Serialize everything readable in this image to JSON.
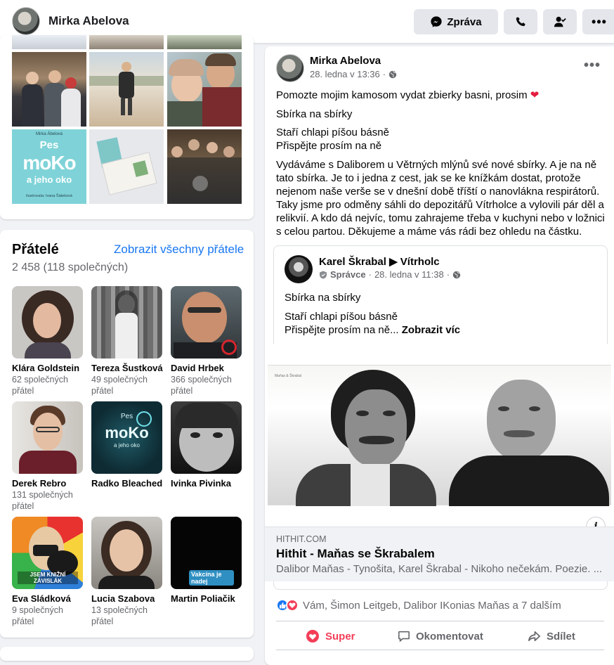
{
  "header": {
    "profile_name": "Mirka Abelova",
    "message_label": "Zpráva"
  },
  "photos": {
    "book_cover": {
      "author": "Mirka Ábelová",
      "title_line1": "Pes",
      "title_line2": "moKo",
      "title_line3": "a jeho oko",
      "illustrator": "ilustrovala: Ivana Šáteková"
    }
  },
  "friends": {
    "title": "Přátelé",
    "see_all": "Zobrazit všechny přátele",
    "count": "2 458 (118 společných)",
    "items": [
      {
        "name": "Klára Goldstein",
        "mutual": "62 společných přátel"
      },
      {
        "name": "Tereza Šustková",
        "mutual": "49 společných přátel"
      },
      {
        "name": "David Hrbek",
        "mutual": "366 společných přátel"
      },
      {
        "name": "Derek Rebro",
        "mutual": "131 společných přátel"
      },
      {
        "name": "Radko Bleached",
        "mutual": ""
      },
      {
        "name": "Ivinka Pivinka",
        "mutual": ""
      },
      {
        "name": "Eva Sládková",
        "mutual": "9 společných přátel"
      },
      {
        "name": "Lucia Szabova",
        "mutual": "13 společných přátel"
      },
      {
        "name": "Martin Poliačik",
        "mutual": ""
      }
    ],
    "image_texts": {
      "radko_title": "moKo",
      "eva_badge": "JSEM KNIŽNÍ ZÁVISLÁK",
      "martin_sign": "Vakcína je nadej"
    }
  },
  "post": {
    "author": "Mirka Abelova",
    "timestamp": "28. ledna v 13:36",
    "line1": "Pomozte mojim kamosom vydat zbierky basni, prosim",
    "line2": "Sbírka na sbírky",
    "line3a": "Staří chlapi píšou básně",
    "line3b": "Přispějte prosím na ně",
    "para": "Vydáváme s Daliborem u Větrných mlýnů své nové sbírky. A je na ně tato sbírka. Je to i jedna z cest, jak se ke knížkám dostat, protože nejenom naše verše se v dnešní době tříští o nanovlákna respirátorů. Taky jsme pro odměny sáhli do depozitářů Vítrholce a vylovili pár děl a relikvií. A kdo dá nejvíc, tomu zahrajeme třeba v kuchyni nebo v ložnici s celou partou. Děkujeme a máme vás rádi bez ohledu na částku.",
    "shared": {
      "author": "Karel Škrabal",
      "group": "Vítrholc",
      "role": "Správce",
      "timestamp": "28. ledna v 11:38",
      "line1": "Sbírka na sbírky",
      "line2a": "Staří chlapi píšou básně",
      "line2b": "Přispějte prosím na ně...",
      "see_more": "Zobrazit víc",
      "image_caption": "Maňas & Škrabal"
    },
    "link": {
      "domain": "HITHIT.COM",
      "title": "Hithit - Maňas se Škrabalem",
      "description": "Dalibor Maňas - Tynošita, Karel Škrabal - Nikoho nečekám. Poezie. ..."
    },
    "reactions_text": "Vám, Šimon Leitgeb, Dalibor IKonias Maňas a 7 dalším",
    "actions": {
      "super": "Super",
      "comment": "Okomentovat",
      "share": "Sdílet"
    }
  }
}
